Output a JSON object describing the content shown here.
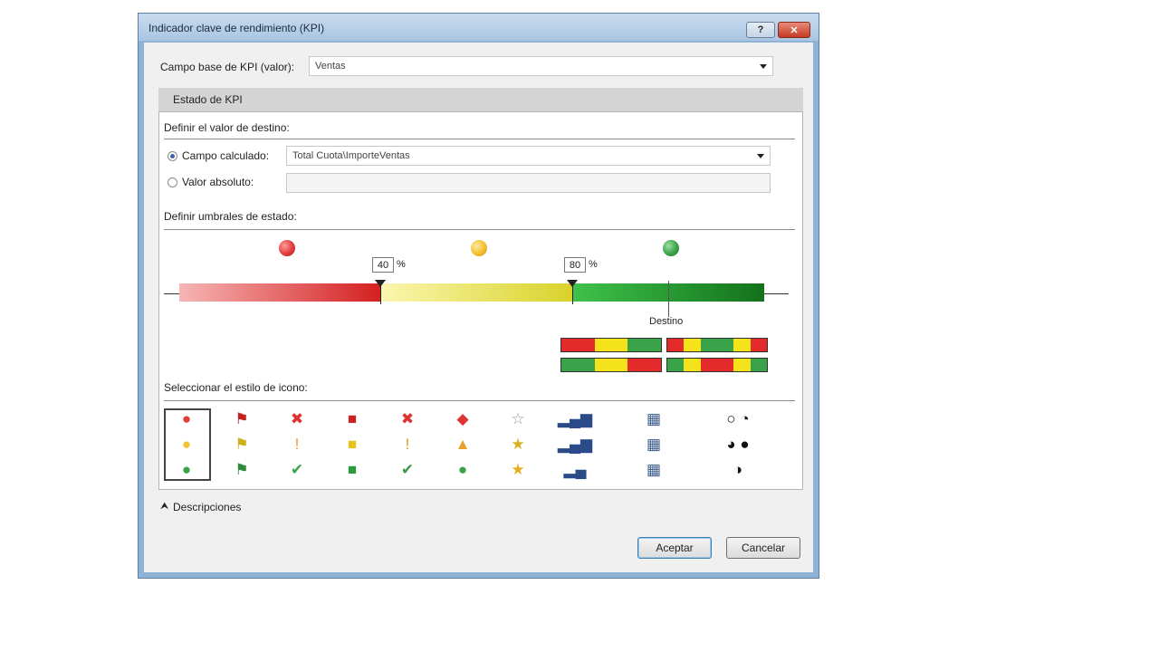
{
  "window": {
    "title": "Indicador clave de rendimiento (KPI)",
    "help_glyph": "?",
    "close_glyph": "✕"
  },
  "base_field": {
    "label": "Campo base de KPI (valor):",
    "value": "Ventas"
  },
  "section_header": "Estado de KPI",
  "target": {
    "heading": "Definir el valor de destino:",
    "calculated_label": "Campo calculado:",
    "calculated_value": "Total Cuota\\ImporteVentas",
    "calculated_selected": true,
    "absolute_label": "Valor absoluto:",
    "absolute_value": ""
  },
  "thresholds": {
    "heading": "Definir umbrales de estado:",
    "low": "40",
    "high": "80",
    "unit": "%",
    "target_label": "Destino",
    "colors": {
      "red": "#e23c3c",
      "yellow": "#f2c12e",
      "green": "#3aa34a"
    }
  },
  "icon_style": {
    "heading": "Seleccionar el estilo de icono:",
    "columns": [
      {
        "name": "circles",
        "icons": [
          "●",
          "●",
          "●"
        ]
      },
      {
        "name": "flags",
        "icons": [
          "⚑",
          "⚑",
          "⚑"
        ]
      },
      {
        "name": "symbols",
        "icons": [
          "✖",
          "!",
          "✔"
        ]
      },
      {
        "name": "traffic-lights",
        "icons": [
          "■",
          "■",
          "■"
        ]
      },
      {
        "name": "marks",
        "icons": [
          "✖",
          "!",
          "✔"
        ]
      },
      {
        "name": "shapes",
        "icons": [
          "◆",
          "▲",
          "●"
        ]
      },
      {
        "name": "stars",
        "icons": [
          "☆",
          "★",
          "★"
        ]
      },
      {
        "name": "bars",
        "icons": [
          "▂▄▆",
          "▂▄▆",
          "▂▄"
        ]
      },
      {
        "name": "boxes",
        "icons": [
          "▦",
          "▦",
          "▦"
        ]
      },
      {
        "name": "pies",
        "icons": [
          "○ ◔",
          "◕ ●",
          "◑"
        ]
      }
    ]
  },
  "descriptions_label": "Descripciones",
  "buttons": {
    "ok": "Aceptar",
    "cancel": "Cancelar"
  }
}
